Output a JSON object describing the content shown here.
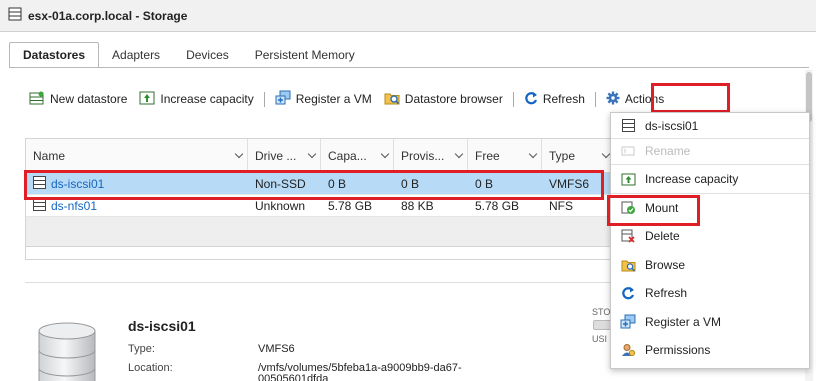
{
  "window": {
    "title": "esx-01a.corp.local - Storage"
  },
  "tabs": [
    "Datastores",
    "Adapters",
    "Devices",
    "Persistent Memory"
  ],
  "toolbar": {
    "new_datastore": "New datastore",
    "increase_capacity": "Increase capacity",
    "register_vm": "Register a VM",
    "datastore_browser": "Datastore browser",
    "refresh": "Refresh",
    "actions": "Actions"
  },
  "table": {
    "columns": [
      "Name",
      "Drive ...",
      "Capa...",
      "Provis...",
      "Free",
      "Type"
    ],
    "rows": [
      {
        "name": "ds-iscsi01",
        "drive": "Non-SSD",
        "capacity": "0 B",
        "provisioned": "0 B",
        "free": "0 B",
        "type": "VMFS6"
      },
      {
        "name": "ds-nfs01",
        "drive": "Unknown",
        "capacity": "5.78 GB",
        "provisioned": "88 KB",
        "free": "5.78 GB",
        "type": "NFS"
      }
    ]
  },
  "summary": {
    "name": "ds-iscsi01",
    "type_label": "Type:",
    "type_value": "VMFS6",
    "location_label": "Location:",
    "location_value_1": "/vmfs/volumes/5bfeba1a-a9009bb9-da67-",
    "location_value_2": "00505601dfda",
    "storage_label_top": "STO",
    "storage_label_bottom": "USI"
  },
  "context_menu": {
    "header": "ds-iscsi01",
    "items": [
      "Rename",
      "Increase capacity",
      "Mount",
      "Delete",
      "Browse",
      "Refresh",
      "Register a VM",
      "Permissions"
    ]
  },
  "colors": {
    "highlight": "#e01e26",
    "selection": "#b7dbf7",
    "link": "#1565c0"
  }
}
